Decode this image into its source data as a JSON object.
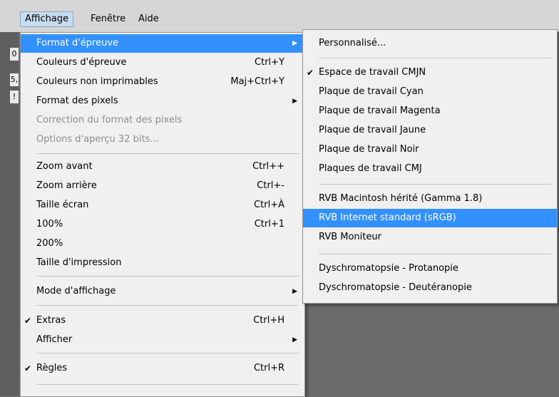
{
  "menubar": {
    "items": [
      {
        "label": "Affichage",
        "active": true
      },
      {
        "label": "Fenêtre",
        "active": false
      },
      {
        "label": "Aide",
        "active": false
      }
    ]
  },
  "left_strip": [
    "0",
    "5,",
    "!"
  ],
  "main_menu": {
    "items": [
      {
        "label": "Format d'épreuve",
        "submenu": true,
        "highlighted": true
      },
      {
        "label": "Couleurs d'épreuve",
        "accel": "Ctrl+Y"
      },
      {
        "label": "Couleurs non imprimables",
        "accel": "Maj+Ctrl+Y"
      },
      {
        "label": "Format des pixels",
        "submenu": true
      },
      {
        "label": "Correction du format des pixels",
        "disabled": true
      },
      {
        "label": "Options d'aperçu 32 bits...",
        "disabled": true
      },
      {
        "label": "Zoom avant",
        "accel": "Ctrl++"
      },
      {
        "label": "Zoom arrière",
        "accel": "Ctrl+-"
      },
      {
        "label": "Taille écran",
        "accel": "Ctrl+À"
      },
      {
        "label": "100%",
        "accel": "Ctrl+1"
      },
      {
        "label": "200%"
      },
      {
        "label": "Taille d'impression"
      },
      {
        "label": "Mode d'affichage",
        "submenu": true
      },
      {
        "label": "Extras",
        "accel": "Ctrl+H",
        "checked": true
      },
      {
        "label": "Afficher",
        "submenu": true
      },
      {
        "label": "Règles",
        "accel": "Ctrl+R",
        "checked": true
      }
    ]
  },
  "sub_menu": {
    "items": [
      {
        "label": "Personnalisé..."
      },
      {
        "label": "Espace de travail CMJN",
        "checked": true
      },
      {
        "label": "Plaque de travail Cyan"
      },
      {
        "label": "Plaque de travail Magenta"
      },
      {
        "label": "Plaque de travail Jaune"
      },
      {
        "label": "Plaque de travail Noir"
      },
      {
        "label": "Plaques de travail CMJ"
      },
      {
        "label": "RVB Macintosh hérité (Gamma 1.8)"
      },
      {
        "label": "RVB Internet standard (sRGB)",
        "highlighted": true
      },
      {
        "label": "RVB Moniteur"
      },
      {
        "label": "Dyschromatopsie - Protanopie"
      },
      {
        "label": "Dyschromatopsie - Deutéranopie"
      }
    ]
  },
  "icons": {
    "check": "checkmark-icon",
    "submenu": "submenu-arrow-icon"
  },
  "colors": {
    "highlight": "#3390ff",
    "menu_bg": "#f0f0f0",
    "disabled_text": "#8d8d8d",
    "canvas_bg": "#6b6b6b"
  }
}
